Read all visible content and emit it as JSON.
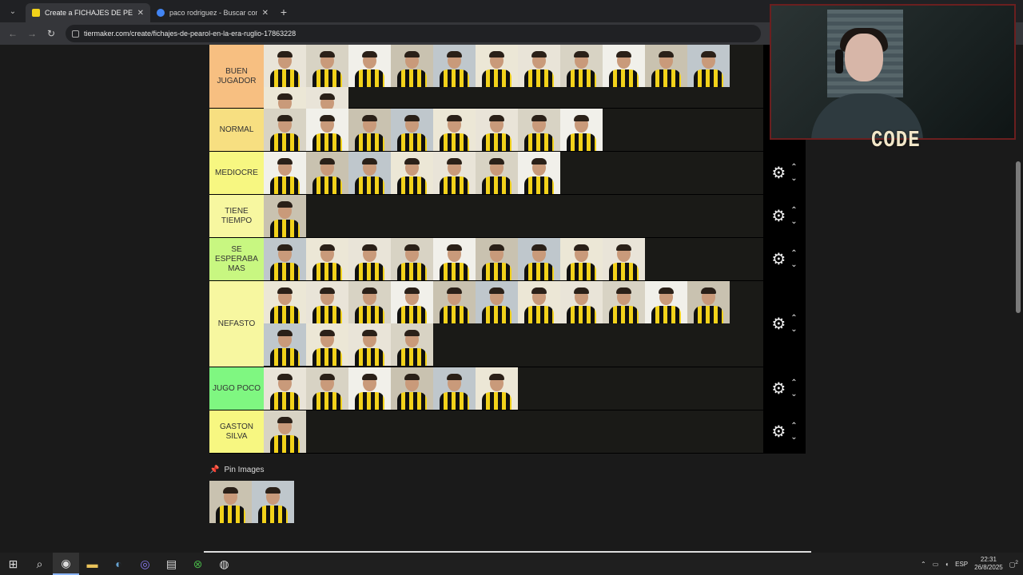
{
  "browser": {
    "tabs": [
      {
        "title": "Create a FICHAJES DE PEÑAROL",
        "active": true,
        "favicon_color": "#f2d21a"
      },
      {
        "title": "paco rodriguez - Buscar con Go",
        "active": false,
        "favicon_color": "#4285f4"
      }
    ],
    "url": "tiermaker.com/create/fichajes-de-pearol-en-la-era-ruglio-17863228"
  },
  "tiers": [
    {
      "label": "BUEN JUGADOR",
      "color": "#f7bf81",
      "count": 13
    },
    {
      "label": "NORMAL",
      "color": "#f7df81",
      "count": 8
    },
    {
      "label": "MEDIOCRE",
      "color": "#f7f781",
      "count": 7
    },
    {
      "label": "TIENE TIEMPO",
      "color": "#f7f7a0",
      "count": 1
    },
    {
      "label": "SE ESPERABA MAS",
      "color": "#c8f781",
      "count": 9
    },
    {
      "label": "NEFASTO",
      "color": "#f7f7a0",
      "count": 15
    },
    {
      "label": "JUGO POCO",
      "color": "#7ff781",
      "count": 6
    },
    {
      "label": "GASTON SILVA",
      "color": "#f7f781",
      "count": 1
    }
  ],
  "pin": {
    "label": "Pin Images",
    "count": 2
  },
  "webcam": {
    "badge": "CODE"
  },
  "taskbar": {
    "lang": "ESP",
    "time": "22:31",
    "date": "26/8/2025",
    "notifications": "2"
  }
}
